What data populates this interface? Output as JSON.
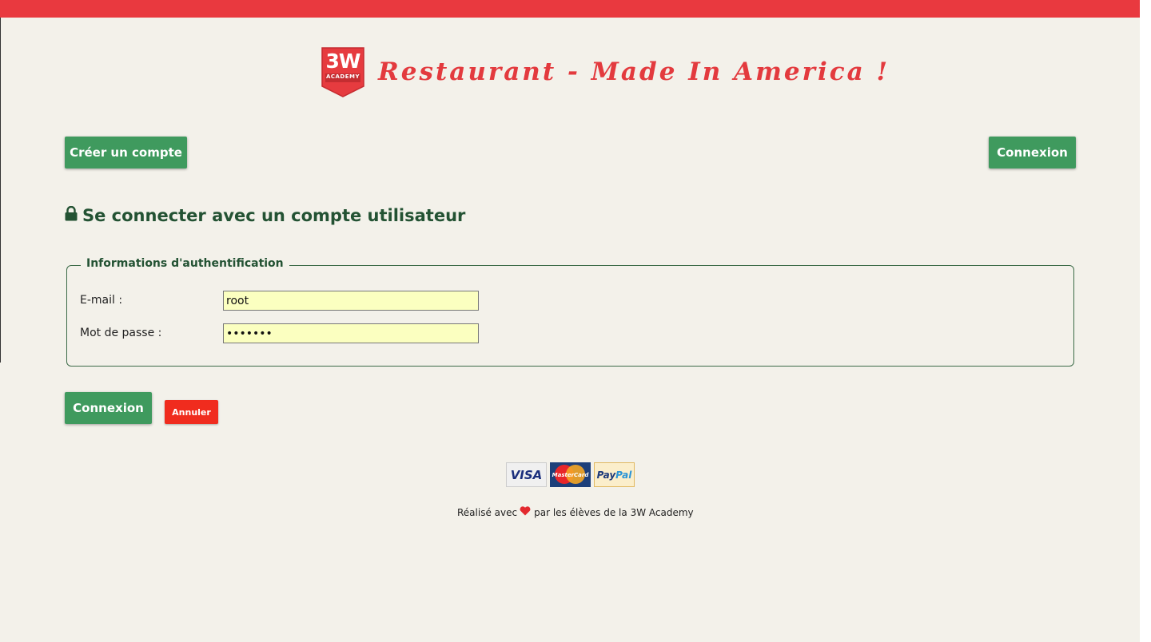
{
  "colors": {
    "topbar": "#e9393f",
    "brand_red": "#e33a3e",
    "button_green": "#3f9a5e",
    "cancel_red": "#f02c1e",
    "heading_green": "#235233",
    "input_bg": "#fbffc0",
    "page_bg": "#f3f1ea"
  },
  "header": {
    "logo_big": "3W",
    "logo_small": "ACADEMY",
    "title": "Restaurant - Made In America !"
  },
  "nav": {
    "create_account": "Créer un compte",
    "login": "Connexion"
  },
  "page": {
    "lock_icon": "lock-icon",
    "heading": "Se connecter avec un compte utilisateur"
  },
  "form": {
    "legend": "Informations d'authentification",
    "email_label": "E-mail :",
    "email_value": "root",
    "password_label": "Mot de passe :",
    "password_value": "1234567",
    "submit": "Connexion",
    "cancel": "Annuler"
  },
  "payments": {
    "visa": "VISA",
    "mastercard": "MasterCard",
    "paypal_dark": "Pay",
    "paypal_light": "Pal"
  },
  "footer": {
    "before_heart": "Réalisé avec",
    "heart_icon": "heart-icon",
    "after_heart": "par les élèves de la 3W Academy"
  }
}
